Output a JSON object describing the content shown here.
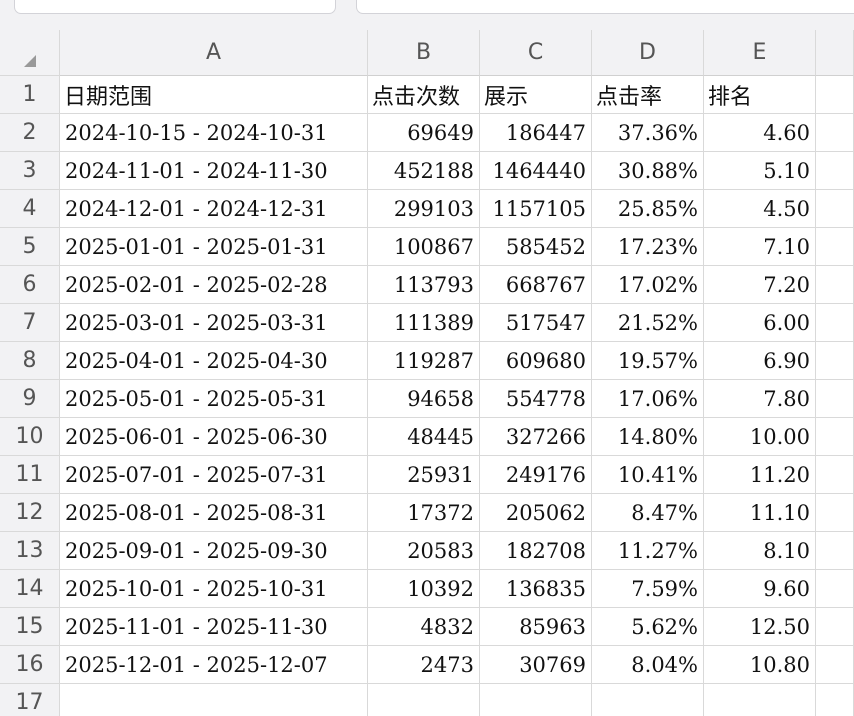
{
  "columns": [
    "A",
    "B",
    "C",
    "D",
    "E"
  ],
  "header_row": {
    "row_number": "1",
    "cells": [
      "日期范围",
      "点击次数",
      "展示",
      "点击率",
      "排名"
    ]
  },
  "rows": [
    {
      "n": "2",
      "range": "2024-10-15 - 2024-10-31",
      "clicks": "69649",
      "impressions": "186447",
      "ctr": "37.36%",
      "rank": "4.60"
    },
    {
      "n": "3",
      "range": "2024-11-01 - 2024-11-30",
      "clicks": "452188",
      "impressions": "1464440",
      "ctr": "30.88%",
      "rank": "5.10"
    },
    {
      "n": "4",
      "range": "2024-12-01 - 2024-12-31",
      "clicks": "299103",
      "impressions": "1157105",
      "ctr": "25.85%",
      "rank": "4.50"
    },
    {
      "n": "5",
      "range": "2025-01-01 - 2025-01-31",
      "clicks": "100867",
      "impressions": "585452",
      "ctr": "17.23%",
      "rank": "7.10"
    },
    {
      "n": "6",
      "range": "2025-02-01 - 2025-02-28",
      "clicks": "113793",
      "impressions": "668767",
      "ctr": "17.02%",
      "rank": "7.20"
    },
    {
      "n": "7",
      "range": "2025-03-01 - 2025-03-31",
      "clicks": "111389",
      "impressions": "517547",
      "ctr": "21.52%",
      "rank": "6.00"
    },
    {
      "n": "8",
      "range": "2025-04-01 - 2025-04-30",
      "clicks": "119287",
      "impressions": "609680",
      "ctr": "19.57%",
      "rank": "6.90"
    },
    {
      "n": "9",
      "range": "2025-05-01 - 2025-05-31",
      "clicks": "94658",
      "impressions": "554778",
      "ctr": "17.06%",
      "rank": "7.80"
    },
    {
      "n": "10",
      "range": "2025-06-01 - 2025-06-30",
      "clicks": "48445",
      "impressions": "327266",
      "ctr": "14.80%",
      "rank": "10.00"
    },
    {
      "n": "11",
      "range": "2025-07-01 - 2025-07-31",
      "clicks": "25931",
      "impressions": "249176",
      "ctr": "10.41%",
      "rank": "11.20"
    },
    {
      "n": "12",
      "range": "2025-08-01 - 2025-08-31",
      "clicks": "17372",
      "impressions": "205062",
      "ctr": "8.47%",
      "rank": "11.10"
    },
    {
      "n": "13",
      "range": "2025-09-01 - 2025-09-30",
      "clicks": "20583",
      "impressions": "182708",
      "ctr": "11.27%",
      "rank": "8.10"
    },
    {
      "n": "14",
      "range": "2025-10-01 - 2025-10-31",
      "clicks": "10392",
      "impressions": "136835",
      "ctr": "7.59%",
      "rank": "9.60"
    },
    {
      "n": "15",
      "range": "2025-11-01 - 2025-11-30",
      "clicks": "4832",
      "impressions": "85963",
      "ctr": "5.62%",
      "rank": "12.50"
    },
    {
      "n": "16",
      "range": "2025-12-01 - 2025-12-07",
      "clicks": "2473",
      "impressions": "30769",
      "ctr": "8.04%",
      "rank": "10.80"
    }
  ],
  "empty_row_number": "17",
  "colors": {
    "header_bg": "#f2f2f4",
    "grid_line": "#d9d9d9",
    "text": "#111111"
  }
}
